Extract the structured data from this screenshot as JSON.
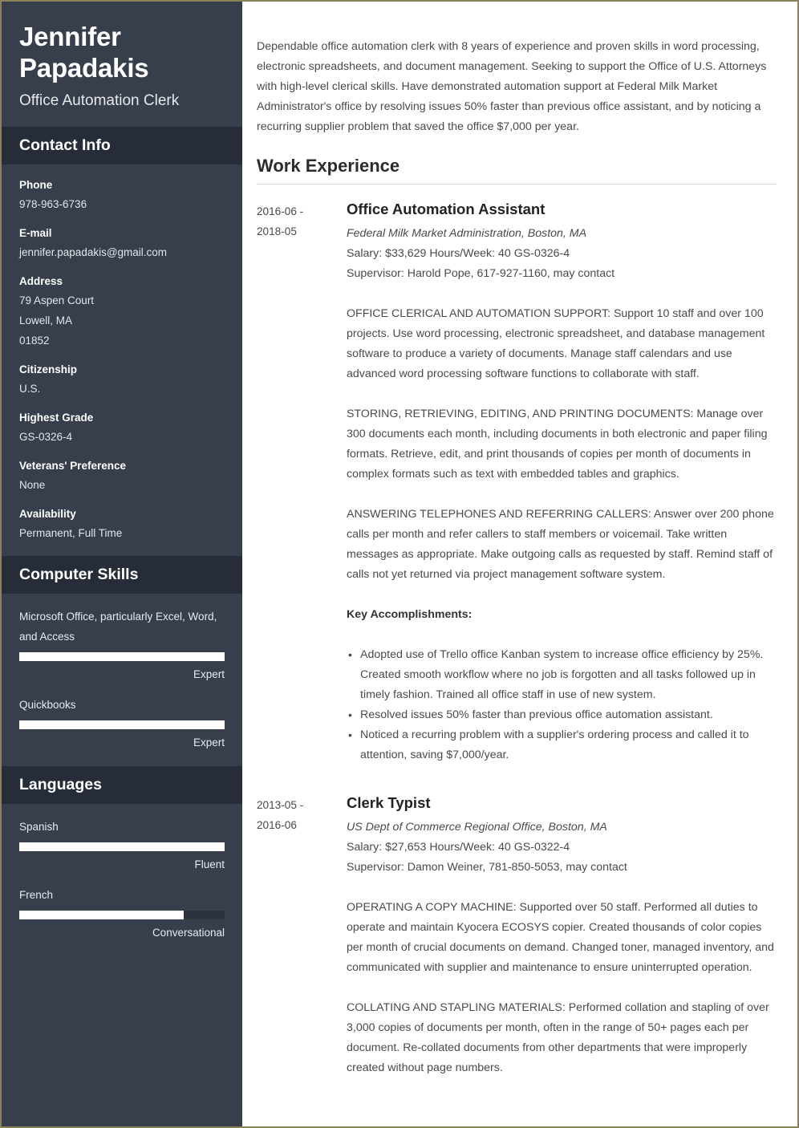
{
  "colors": {
    "sidebar_bg": "#373f4d",
    "sidebar_band_bg": "#272d38",
    "bar_fill": "#ffffff",
    "bar_track": "#2c333d",
    "page_border": "#8a8258",
    "body_text": "#4a4a4a"
  },
  "sidebar": {
    "name": "Jennifer Papadakis",
    "job_title": "Office Automation Clerk",
    "contact_section_title": "Contact Info",
    "contact_items": [
      {
        "label": "Phone",
        "value": "978-963-6736"
      },
      {
        "label": "E-mail",
        "value": "jennifer.papadakis@gmail.com"
      },
      {
        "label": "Address",
        "line1": "79 Aspen Court",
        "line2": "Lowell, MA",
        "line3": "01852"
      },
      {
        "label": "Citizenship",
        "value": "U.S."
      },
      {
        "label": "Highest Grade",
        "value": "GS-0326-4"
      },
      {
        "label": "Veterans' Preference",
        "value": "None"
      },
      {
        "label": "Availability",
        "value": "Permanent, Full Time"
      }
    ],
    "skills_section_title": "Computer Skills",
    "skills": [
      {
        "name": "Microsoft Office, particularly Excel, Word, and Access",
        "level": "Expert",
        "percent": 100
      },
      {
        "name": "Quickbooks",
        "level": "Expert",
        "percent": 100
      }
    ],
    "languages_section_title": "Languages",
    "languages": [
      {
        "name": "Spanish",
        "level": "Fluent",
        "percent": 100
      },
      {
        "name": "French",
        "level": "Conversational",
        "percent": 80
      }
    ]
  },
  "main": {
    "summary": "Dependable office automation clerk with 8 years of experience and proven skills in word processing, electronic spreadsheets, and document management. Seeking to support the Office of U.S. Attorneys with high-level clerical skills. Have demonstrated automation support at Federal Milk Market Administrator's office by resolving issues 50% faster than previous office assistant, and by noticing a recurring supplier problem that saved the office $7,000 per year.",
    "work_experience_title": "Work Experience",
    "jobs": [
      {
        "date_start": "2016-06 -",
        "date_end": "2018-05",
        "role": "Office Automation Assistant",
        "employer": "Federal Milk Market Administration, Boston, MA",
        "salary_line": "Salary: $33,629  Hours/Week: 40  GS-0326-4",
        "supervisor_line": "Supervisor: Harold Pope, 617-927-1160, may contact",
        "paragraphs": [
          "OFFICE CLERICAL AND AUTOMATION SUPPORT: Support 10 staff and over 100 projects. Use word processing, electronic spreadsheet, and database management software to produce a variety of documents. Manage staff calendars and use advanced word processing software functions to collaborate with staff.",
          "STORING, RETRIEVING, EDITING, AND PRINTING DOCUMENTS: Manage over 300 documents each month, including documents in both electronic and paper filing formats. Retrieve, edit, and print thousands of copies per month of documents in complex formats such as text with embedded tables and graphics.",
          "ANSWERING TELEPHONES AND REFERRING CALLERS: Answer over 200 phone calls per month and refer callers to staff members or voicemail. Take written messages as appropriate. Make outgoing calls as requested by staff. Remind staff of calls not yet returned via project management software system."
        ],
        "accomplishments_title": "Key Accomplishments:",
        "accomplishments": [
          "Adopted use of Trello office Kanban system to increase office efficiency by 25%. Created smooth workflow where no job is forgotten and all tasks followed up in timely fashion. Trained all office staff in use of new system.",
          "Resolved issues 50% faster than previous office automation assistant.",
          "Noticed a recurring problem with a supplier's ordering process and called it to attention, saving $7,000/year."
        ]
      },
      {
        "date_start": "2013-05 -",
        "date_end": "2016-06",
        "role": "Clerk Typist",
        "employer": "US Dept of Commerce Regional Office, Boston, MA",
        "salary_line": "Salary: $27,653  Hours/Week: 40  GS-0322-4",
        "supervisor_line": "Supervisor: Damon Weiner, 781-850-5053, may contact",
        "paragraphs": [
          "OPERATING A COPY MACHINE: Supported over 50 staff. Performed all duties to operate and maintain Kyocera ECOSYS copier. Created thousands of color copies per month of crucial documents on demand. Changed toner, managed inventory, and communicated with supplier and maintenance to ensure uninterrupted operation.",
          "COLLATING AND STAPLING MATERIALS: Performed collation and stapling of over 3,000 copies of documents per month, often in the range of 50+ pages each per document. Re-collated documents from other departments that were improperly created without page numbers."
        ],
        "accomplishments_title": "",
        "accomplishments": []
      }
    ]
  }
}
